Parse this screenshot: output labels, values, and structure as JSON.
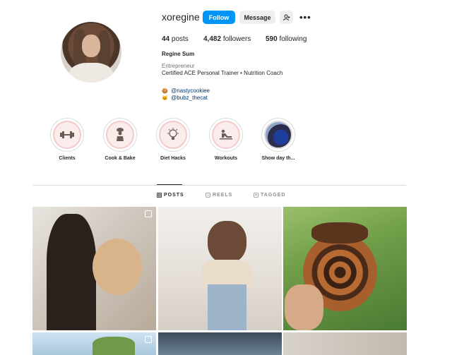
{
  "profile": {
    "username": "xoregine",
    "follow_label": "Follow",
    "message_label": "Message",
    "posts_count": "44",
    "posts_label": "posts",
    "followers_count": "4,482",
    "followers_label": "followers",
    "following_count": "590",
    "following_label": "following",
    "full_name": "Regine Sum",
    "category": "Entrepreneur",
    "bio": "Certified ACE Personal Trainer • Nutrition Coach",
    "links": [
      {
        "emoji": "🍪",
        "text": "@nastycookiee"
      },
      {
        "emoji": "🐱",
        "text": "@bubz_thecat"
      }
    ]
  },
  "highlights": [
    {
      "label": "Clients",
      "icon": "dumbbell-icon"
    },
    {
      "label": "Cook & Bake",
      "icon": "chef-icon"
    },
    {
      "label": "Diet Hacks",
      "icon": "lightbulb-icon"
    },
    {
      "label": "Workouts",
      "icon": "workout-icon"
    },
    {
      "label": "Show day th...",
      "icon": "photo-icon"
    }
  ],
  "tabs": [
    {
      "label": "POSTS",
      "icon": "grid-icon",
      "active": true
    },
    {
      "label": "REELS",
      "icon": "reels-icon",
      "active": false
    },
    {
      "label": "TAGGED",
      "icon": "tagged-icon",
      "active": false
    }
  ],
  "colors": {
    "accent": "#0095f6",
    "link": "#00376b",
    "highlight_ring": "#f4c9c9"
  }
}
